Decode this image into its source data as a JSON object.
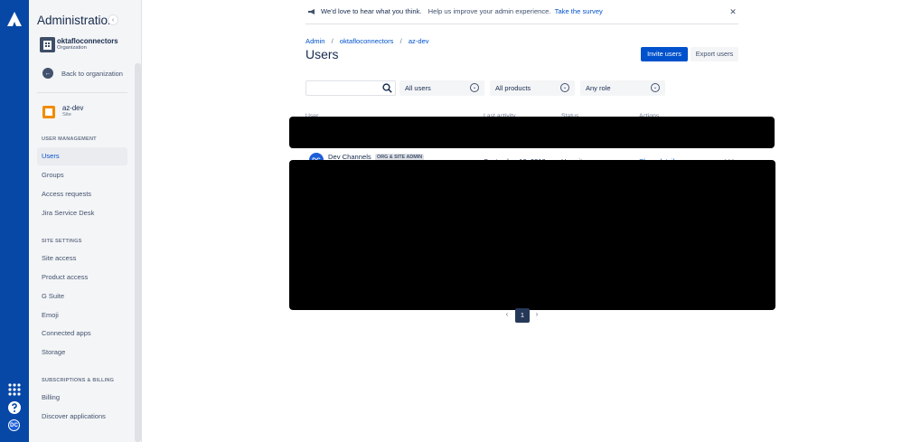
{
  "rail": {
    "icons": [
      "atlassian-logo-icon",
      "app-switcher-icon",
      "help-icon"
    ],
    "avatar_initials": "DC"
  },
  "sidebar": {
    "title": "Administration",
    "org": {
      "name": "oktafloconnectors",
      "type": "Organization"
    },
    "back_label": "Back to organization",
    "site": {
      "name": "az-dev",
      "type": "Site"
    },
    "sections": {
      "user_management": "USER MANAGEMENT",
      "site_settings": "SITE SETTINGS",
      "subscriptions": "SUBSCRIPTIONS & BILLING"
    },
    "user_management_items": [
      "Users",
      "Groups",
      "Access requests",
      "Jira Service Desk"
    ],
    "site_settings_items": [
      "Site access",
      "Product access",
      "G Suite",
      "Emoji",
      "Connected apps",
      "Storage"
    ],
    "subscription_items": [
      "Billing",
      "Discover applications"
    ]
  },
  "banner": {
    "bold": "We'd love to hear what you think.",
    "normal": "Help us improve your admin experience.",
    "link": "Take the survey"
  },
  "breadcrumbs": [
    "Admin",
    "oktafloconnectors",
    "az-dev"
  ],
  "page": {
    "title": "Users",
    "invite_label": "Invite users",
    "export_label": "Export users"
  },
  "filters": {
    "search_value": "",
    "search_placeholder": "",
    "users": "All users",
    "products": "All products",
    "role": "Any role"
  },
  "table": {
    "headers": {
      "user": "User",
      "last_activity": "Last activity",
      "status": "Status",
      "actions": "Actions"
    },
    "rows": [
      {
        "initials": "DC",
        "name": "Dev Channels",
        "badge": "ORG & SITE ADMIN",
        "last_activity": "September 10, 2019",
        "status": "Has site access",
        "action": "Show details",
        "more": "•••"
      }
    ]
  },
  "pagination": {
    "current": "1",
    "prev": "‹",
    "next": "›"
  },
  "colors": {
    "rail": "#0747a6",
    "primary": "#0052cc",
    "text": "#172b4d"
  }
}
